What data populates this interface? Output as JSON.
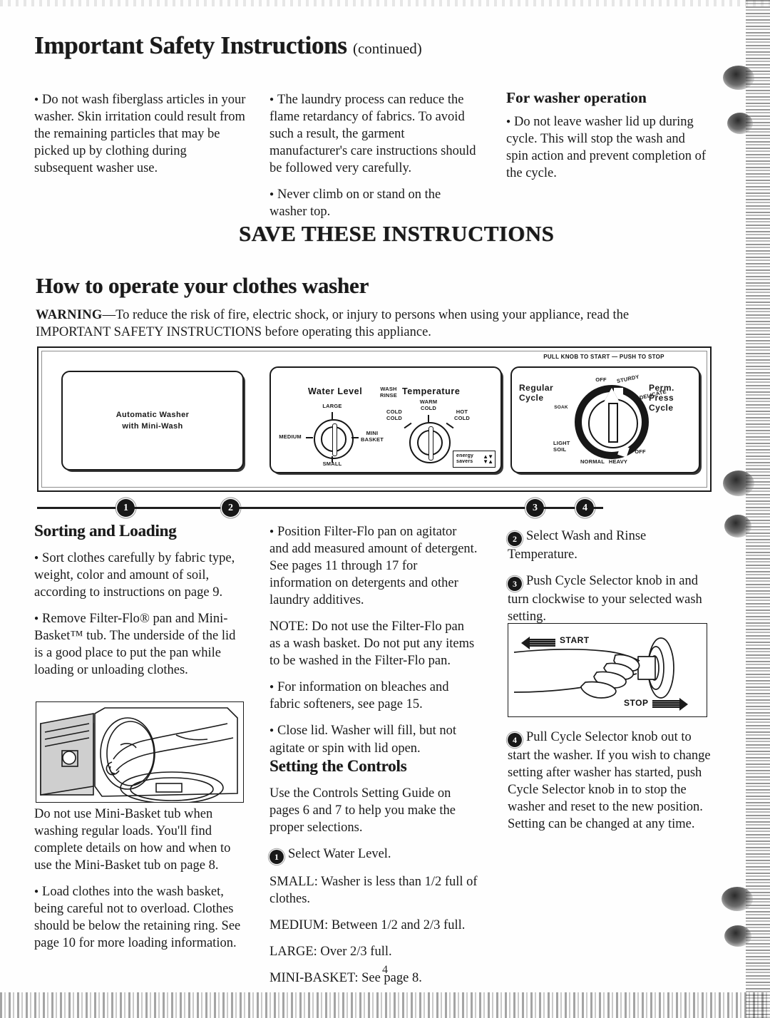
{
  "document": {
    "title": "Important Safety Instructions",
    "title_suffix": "(continued)",
    "page_number": "4"
  },
  "safety": {
    "left_column": [
      "Do not wash fiberglass articles in your washer. Skin irritation could result from the remaining particles that may be picked up by clothing during subsequent washer use."
    ],
    "middle_column": [
      "The laundry process can reduce the flame retardancy of fabrics. To avoid such a result, the garment manufacturer's care instructions should be followed very carefully.",
      "Never climb on or stand on the washer top."
    ],
    "right_column": {
      "heading": "For washer operation",
      "items": [
        "Do not leave washer lid up during cycle. This will stop the wash and spin action and prevent completion of the cycle."
      ]
    }
  },
  "save_banner": "SAVE THESE INSTRUCTIONS",
  "operate_section": {
    "heading": "How to operate your clothes washer",
    "warning_label": "WARNING",
    "warning_text": "—To reduce the risk of fire, electric shock, or injury to persons when using your appliance, read the IMPORTANT SAFETY INSTRUCTIONS before operating this appliance."
  },
  "control_panel": {
    "left_box": {
      "line1": "Automatic Washer",
      "line2": "with Mini-Wash"
    },
    "center_box": {
      "water_level_title": "Water Level",
      "wash_rinse_label": "WASH\nRINSE",
      "temperature_title": "Temperature",
      "water_level_settings": [
        "LARGE",
        "MEDIUM",
        "MINI\nBASKET",
        "SMALL"
      ],
      "temperature_settings": [
        "WARM\nCOLD",
        "COLD\nCOLD",
        "HOT\nCOLD"
      ],
      "energy_badge_line1": "energy",
      "energy_badge_line2": "savers"
    },
    "right_box": {
      "top_instruction": "PULL KNOB TO START — PUSH TO STOP",
      "left_title": "Regular\nCycle",
      "right_title": "Perm.\nPress\nCycle",
      "dial_labels": [
        "OFF",
        "STURDY",
        "DELICATE",
        "OFF",
        "HEAVY",
        "NORMAL",
        "LIGHT\nSOIL",
        "SOAK"
      ]
    },
    "callout_numbers": [
      "1",
      "2",
      "3",
      "4"
    ]
  },
  "sorting_loading": {
    "heading": "Sorting and Loading",
    "bullets": [
      "Sort clothes carefully by fabric type, weight, color and amount of soil, according to instructions on page 9.",
      "Remove Filter-Flo® pan and Mini-Basket™ tub. The underside of the lid is a good place to put the pan while loading or unloading clothes."
    ],
    "caption": "Do not use Mini-Basket tub when washing regular loads. You'll find complete details on how and when to use the Mini-Basket tub on page 8.",
    "bullets_after": [
      "Load clothes into the wash basket, being careful not to overload. Clothes should be below the retaining ring. See page 10 for more loading information."
    ]
  },
  "middle_instructions": {
    "bullets": [
      "Position Filter-Flo pan on agitator and add measured amount of detergent. See pages 11 through 17 for information on detergents and other laundry additives."
    ],
    "note": "NOTE: Do not use the Filter-Flo pan as a wash basket. Do not put any items to be washed in the Filter-Flo pan.",
    "bullets_after": [
      "For information on bleaches and fabric softeners, see page 15.",
      "Close lid. Washer will fill, but not agitate or spin with lid open."
    ]
  },
  "setting_controls": {
    "heading": "Setting the Controls",
    "intro": "Use the Controls Setting Guide on pages 6 and 7 to help you make the proper selections.",
    "step1_number": "1",
    "step1_text": "Select Water Level.",
    "levels": [
      "SMALL: Washer is less than 1/2 full of clothes.",
      "MEDIUM: Between 1/2 and 2/3 full.",
      "LARGE: Over 2/3 full.",
      "MINI-BASKET: See page 8."
    ]
  },
  "right_steps": {
    "step2_number": "2",
    "step2_text": "Select Wash and Rinse Temperature.",
    "step3_number": "3",
    "step3_text": "Push Cycle Selector knob in and turn clockwise to your selected wash setting.",
    "start_label": "START",
    "stop_label": "STOP",
    "step4_number": "4",
    "step4_text": "Pull Cycle Selector knob out to start the washer. If you wish to change setting after washer has started, push Cycle Selector knob in to stop the washer and reset to the new position. Setting can be changed at any time."
  }
}
